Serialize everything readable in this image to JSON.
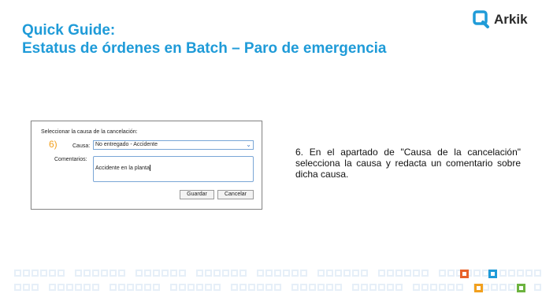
{
  "header": {
    "title_line1": "Quick Guide:",
    "title_line2": "Estatus de órdenes en Batch – Paro de emergencia"
  },
  "logo": {
    "name": "Arkik",
    "icon": "q-logo-icon",
    "color": "#1f9bd8"
  },
  "dialog": {
    "prompt": "Seleccionar la causa de la cancelación:",
    "step_marker": "6)",
    "cause_label": "Causa:",
    "cause_value": "No entregado - Accidente",
    "comments_label": "Comentarios:",
    "comments_value": "Accidente en la planta",
    "save_label": "Guardar",
    "cancel_label": "Cancelar"
  },
  "description": "6. En el apartado de \"Causa de la cancelación\" selecciona la causa y redacta un comentario sobre dicha causa.",
  "decor": {
    "accent_colors": [
      "#e8622a",
      "#1f9bd8",
      "#f2a01e",
      "#6cb33f"
    ]
  }
}
